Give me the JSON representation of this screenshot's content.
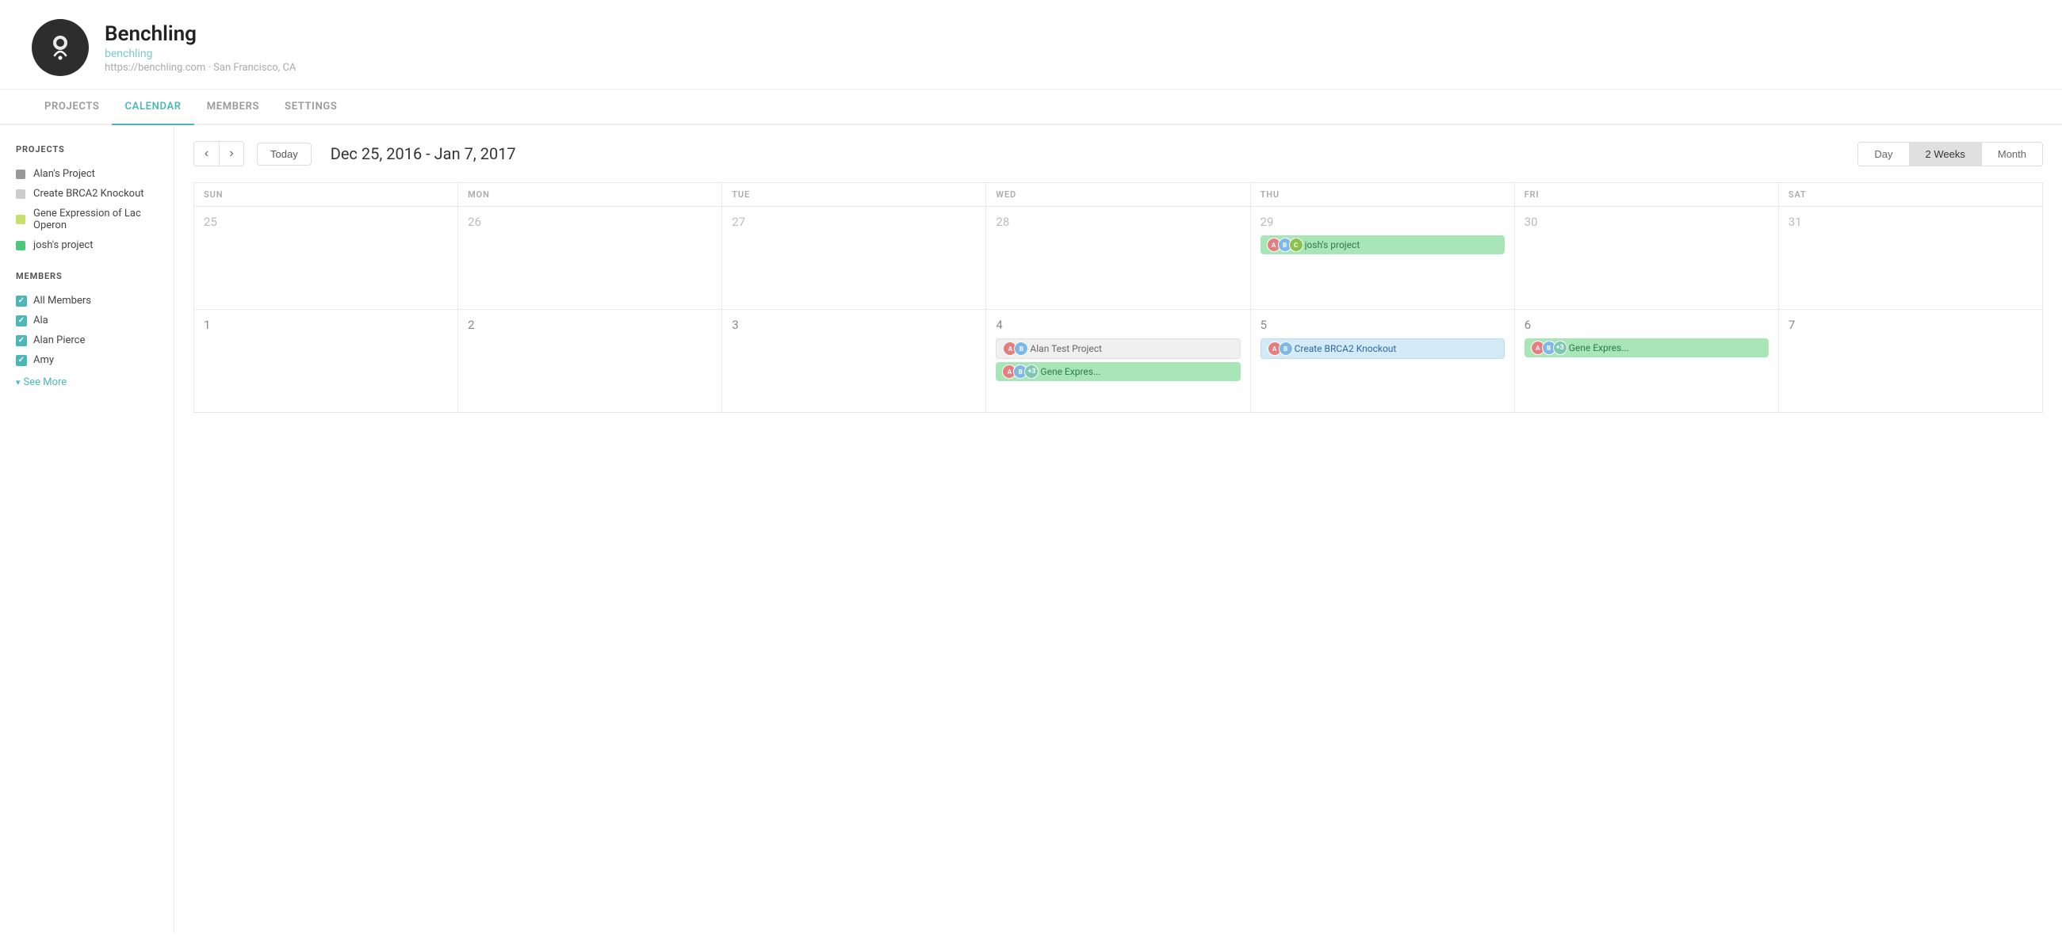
{
  "header": {
    "app_name": "Benchling",
    "subdomain": "benchling",
    "location": "https://benchling.com · San Francisco, CA"
  },
  "nav": {
    "items": [
      {
        "id": "projects",
        "label": "PROJECTS",
        "active": false
      },
      {
        "id": "calendar",
        "label": "CALENDAR",
        "active": true
      },
      {
        "id": "members",
        "label": "MEMBERS",
        "active": false
      },
      {
        "id": "settings",
        "label": "SETTINGS",
        "active": false
      }
    ]
  },
  "sidebar": {
    "projects_title": "PROJECTS",
    "projects": [
      {
        "id": "alans",
        "label": "Alan's Project",
        "color": "gray"
      },
      {
        "id": "brca2",
        "label": "Create BRCA2 Knockout",
        "color": "lightgray"
      },
      {
        "id": "lac",
        "label": "Gene Expression of Lac Operon",
        "color": "yellow"
      },
      {
        "id": "josh",
        "label": "josh's project",
        "color": "green"
      }
    ],
    "members_title": "MEMBERS",
    "members": [
      {
        "id": "all",
        "label": "All Members",
        "checked": true
      },
      {
        "id": "ala",
        "label": "Ala",
        "checked": true
      },
      {
        "id": "alan",
        "label": "Alan Pierce",
        "checked": true
      },
      {
        "id": "amy",
        "label": "Amy",
        "checked": true
      }
    ],
    "see_more_label": "See More"
  },
  "calendar": {
    "prev_label": "‹",
    "next_label": "›",
    "today_label": "Today",
    "date_range": "Dec 25, 2016 - Jan 7, 2017",
    "view_day": "Day",
    "view_2weeks": "2 Weeks",
    "view_month": "Month",
    "headers": [
      "SUN",
      "MON",
      "TUE",
      "WED",
      "THU",
      "FRI",
      "SAT"
    ],
    "weeks": [
      {
        "days": [
          {
            "date": "25",
            "current": false,
            "events": []
          },
          {
            "date": "26",
            "current": false,
            "events": []
          },
          {
            "date": "27",
            "current": false,
            "events": []
          },
          {
            "date": "28",
            "current": false,
            "events": []
          },
          {
            "date": "29",
            "current": false,
            "events": [
              {
                "type": "green",
                "label": "josh's project",
                "avatars": [
                  "av1",
                  "av2",
                  "av3"
                ]
              }
            ]
          },
          {
            "date": "30",
            "current": false,
            "events": []
          },
          {
            "date": "31",
            "current": false,
            "events": []
          }
        ]
      },
      {
        "days": [
          {
            "date": "1",
            "current": true,
            "events": []
          },
          {
            "date": "2",
            "current": true,
            "events": []
          },
          {
            "date": "3",
            "current": true,
            "events": []
          },
          {
            "date": "4",
            "current": true,
            "events": [
              {
                "type": "gray",
                "label": "Alan Test Project",
                "avatars": [
                  "av1",
                  "av2"
                ]
              },
              {
                "type": "green",
                "label": "Gene Expres...",
                "avatars": [
                  "av1",
                  "av2"
                ],
                "extra": "+3"
              }
            ]
          },
          {
            "date": "5",
            "current": true,
            "events": [
              {
                "type": "blue",
                "label": "Create BRCA2 Knockout",
                "avatars": [
                  "av1",
                  "av2"
                ]
              }
            ]
          },
          {
            "date": "6",
            "current": true,
            "events": [
              {
                "type": "green",
                "label": "Gene Expres...",
                "avatars": [
                  "av1",
                  "av2"
                ],
                "extra": "+3"
              }
            ]
          },
          {
            "date": "7",
            "current": true,
            "events": []
          }
        ]
      }
    ]
  }
}
